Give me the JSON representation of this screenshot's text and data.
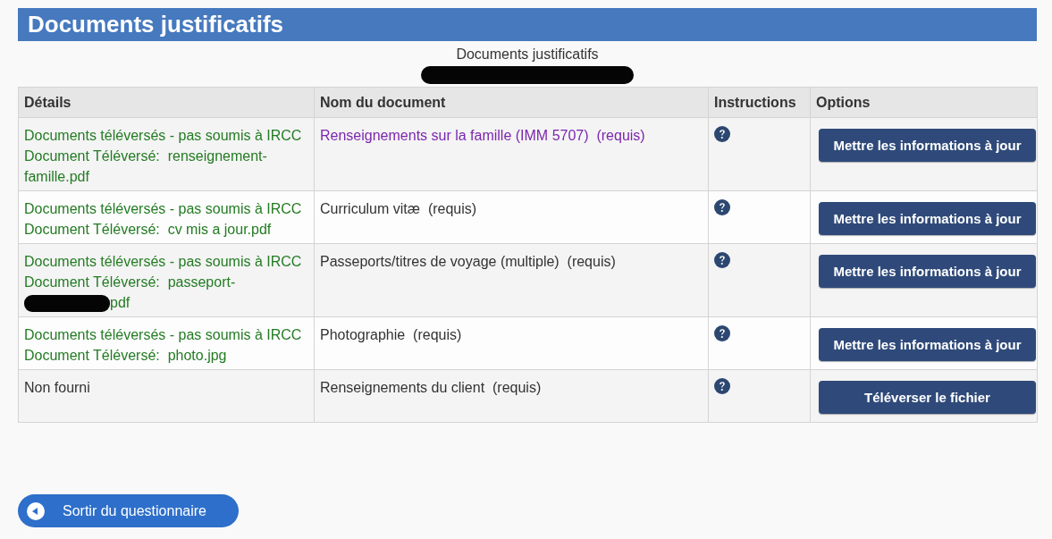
{
  "header": {
    "title": "Documents justificatifs"
  },
  "caption": [
    {
      "kind": "text",
      "text": "Documents justificatifs"
    },
    {
      "kind": "redacted"
    }
  ],
  "table": {
    "columns": [
      "Détails",
      "Nom du document",
      "Instructions",
      "Options"
    ],
    "rows": [
      {
        "details": {
          "kind": "uploaded",
          "status": "Documents téléversés - pas soumis à IRCC",
          "file_parts": [
            {
              "kind": "text",
              "text": "Document Téléversé:  renseignement-famille.pdf"
            }
          ]
        },
        "document": {
          "kind": "link",
          "text": "Renseignements sur la famille (IMM 5707)  (requis)"
        },
        "action": "Mettre les informations à jour"
      },
      {
        "details": {
          "kind": "uploaded",
          "status": "Documents téléversés - pas soumis à IRCC",
          "file_parts": [
            {
              "kind": "text",
              "text": "Document Téléversé:  cv mis a jour.pdf"
            }
          ]
        },
        "document": {
          "kind": "text",
          "text": "Curriculum vitæ  (requis)"
        },
        "action": "Mettre les informations à jour"
      },
      {
        "details": {
          "kind": "uploaded",
          "status": "Documents téléversés - pas soumis à IRCC",
          "file_parts": [
            {
              "kind": "text",
              "text": "Document Téléversé:  passeport-"
            },
            {
              "kind": "redacted"
            },
            {
              "kind": "text",
              "text": "pdf"
            }
          ]
        },
        "document": {
          "kind": "text",
          "text": "Passeports/titres de voyage (multiple)  (requis)"
        },
        "action": "Mettre les informations à jour"
      },
      {
        "details": {
          "kind": "uploaded",
          "status": "Documents téléversés - pas soumis à IRCC",
          "file_parts": [
            {
              "kind": "text",
              "text": "Document Téléversé:  photo.jpg"
            }
          ]
        },
        "document": {
          "kind": "text",
          "text": "Photographie  (requis)"
        },
        "action": "Mettre les informations à jour"
      },
      {
        "details": {
          "kind": "missing",
          "status": "Non fourni"
        },
        "document": {
          "kind": "text",
          "text": "Renseignements du client  (requis)"
        },
        "action": "Téléverser le fichier"
      }
    ]
  },
  "exit_button": {
    "label": "Sortir du questionnaire"
  }
}
